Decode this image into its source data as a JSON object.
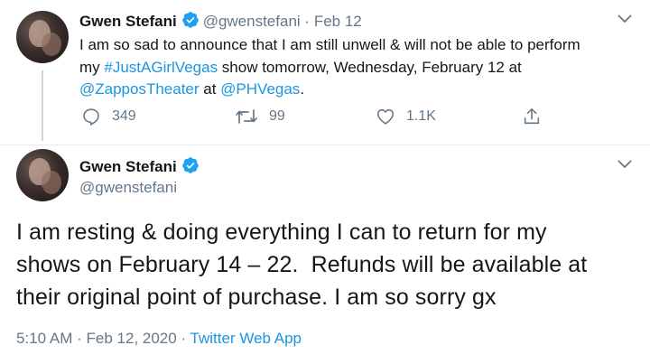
{
  "tweet1": {
    "name": "Gwen Stefani",
    "handle": "@gwenstefani",
    "separator": "·",
    "date": "Feb 12",
    "text_line1": "I am so sad to announce that I am still unwell & will not be able to perform",
    "text_line2_prefix": "my ",
    "hashtag": "#JustAGirlVegas",
    "text_line2_suffix": " show tomorrow, Wednesday, February 12 at",
    "mention1": "@ZapposTheater",
    "text_line3_mid": " at ",
    "mention2": "@PHVegas",
    "text_line3_end": ".",
    "replies": "349",
    "retweets": "99",
    "likes": "1.1K"
  },
  "tweet2": {
    "name": "Gwen Stefani",
    "handle": "@gwenstefani",
    "text_line1": "I am resting & doing everything I can to return for my",
    "text_line2": "shows on February 14 – 22.  Refunds will be available at",
    "text_line3": "their original point of purchase. I am so sorry gx",
    "time": "5:10 AM",
    "separator1": "·",
    "date": "Feb 12, 2020",
    "separator2": "·",
    "source": "Twitter Web App"
  },
  "icons": {
    "verified": "verified-badge-icon",
    "reply": "reply-icon",
    "retweet": "retweet-icon",
    "like": "heart-icon",
    "share": "share-icon",
    "caret": "chevron-down-icon"
  },
  "colors": {
    "link": "#1b95e0",
    "muted": "#657786",
    "verified": "#1da1f2",
    "text": "#14171a"
  }
}
